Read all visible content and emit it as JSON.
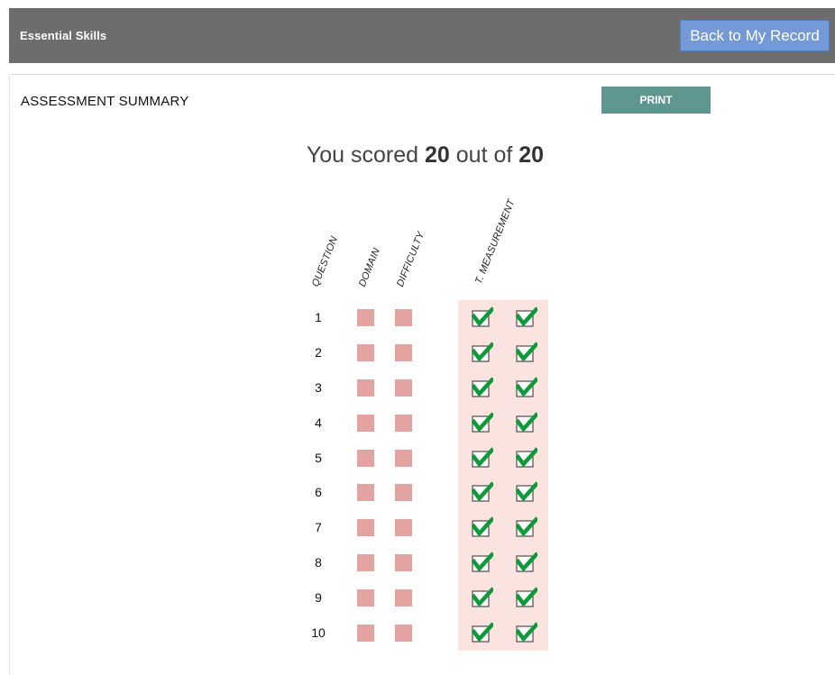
{
  "header": {
    "app_title": "Essential Skills",
    "back_button_label": "Back to My Record"
  },
  "summary": {
    "title": "ASSESSMENT SUMMARY",
    "print_label": "PRINT",
    "score_prefix": "You scored ",
    "score_value": "20",
    "score_middle": " out of ",
    "score_total": "20"
  },
  "columns": {
    "question": "QUESTION",
    "domain": "DOMAIN",
    "difficulty": "DIFFICULTY",
    "measurement": "T. MEASUREMENT"
  },
  "colors": {
    "topbar": "#6d6d6d",
    "back_button": "#7399d6",
    "print_button": "#5f9690",
    "status_square": "#e3a3a1",
    "measurement_bg": "#fbe3df",
    "check_green": "#0f9a3a"
  },
  "rows": [
    {
      "question": "1",
      "checks": [
        "check-icon",
        "check-icon"
      ]
    },
    {
      "question": "2",
      "checks": [
        "check-icon",
        "check-icon"
      ]
    },
    {
      "question": "3",
      "checks": [
        "check-icon",
        "check-icon"
      ]
    },
    {
      "question": "4",
      "checks": [
        "check-icon",
        "check-icon"
      ]
    },
    {
      "question": "5",
      "checks": [
        "check-icon",
        "check-icon"
      ]
    },
    {
      "question": "6",
      "checks": [
        "check-icon",
        "check-icon"
      ]
    },
    {
      "question": "7",
      "checks": [
        "check-icon",
        "check-icon"
      ]
    },
    {
      "question": "8",
      "checks": [
        "check-icon",
        "check-icon"
      ]
    },
    {
      "question": "9",
      "checks": [
        "check-icon",
        "check-icon"
      ]
    },
    {
      "question": "10",
      "checks": [
        "check-icon",
        "check-icon"
      ]
    }
  ]
}
